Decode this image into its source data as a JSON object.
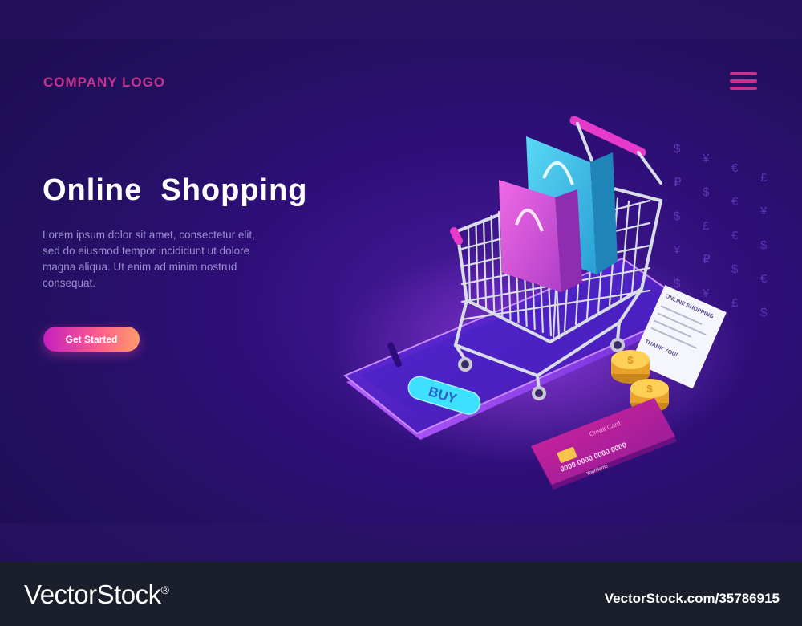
{
  "header": {
    "logo_text": "COMPANY LOGO",
    "menu_icon": "hamburger-menu-icon"
  },
  "hero": {
    "title": "Online  Shopping",
    "description": "Lorem ipsum dolor sit amet, consectetur elit, sed do eiusmod tempor incididunt ut dolore magna aliqua. Ut enim ad minim nostrud consequat.",
    "cta_label": "Get Started"
  },
  "illustration": {
    "phone_button_label": "BUY",
    "receipt_title": "ONLINE SHOPPING",
    "receipt_thanks": "THANK YOU!",
    "card_title": "Credit Card",
    "card_number": "0000 0000 0000 0000",
    "card_name": "YourName",
    "currency_symbols": [
      "$",
      "¥",
      "€",
      "£",
      "₽",
      "$",
      "€",
      "¥",
      "$",
      "£",
      "€",
      "$",
      "¥",
      "₽",
      "$",
      "€",
      "$",
      "¥",
      "£",
      "$"
    ]
  },
  "footer": {
    "brand": "VectorStock",
    "brand_mark": "®",
    "image_id": "VectorStock.com/35786915"
  },
  "colors": {
    "accent_pink": "#c6338f",
    "background": "#2e0f78",
    "footer_bg": "#1a1f2b",
    "cta_gradient_start": "#c41fc0",
    "cta_gradient_end": "#ff9d6c",
    "bag_cyan": "#3bc4e8",
    "bag_pink": "#e04fd6",
    "coin_gold": "#f6b732"
  }
}
